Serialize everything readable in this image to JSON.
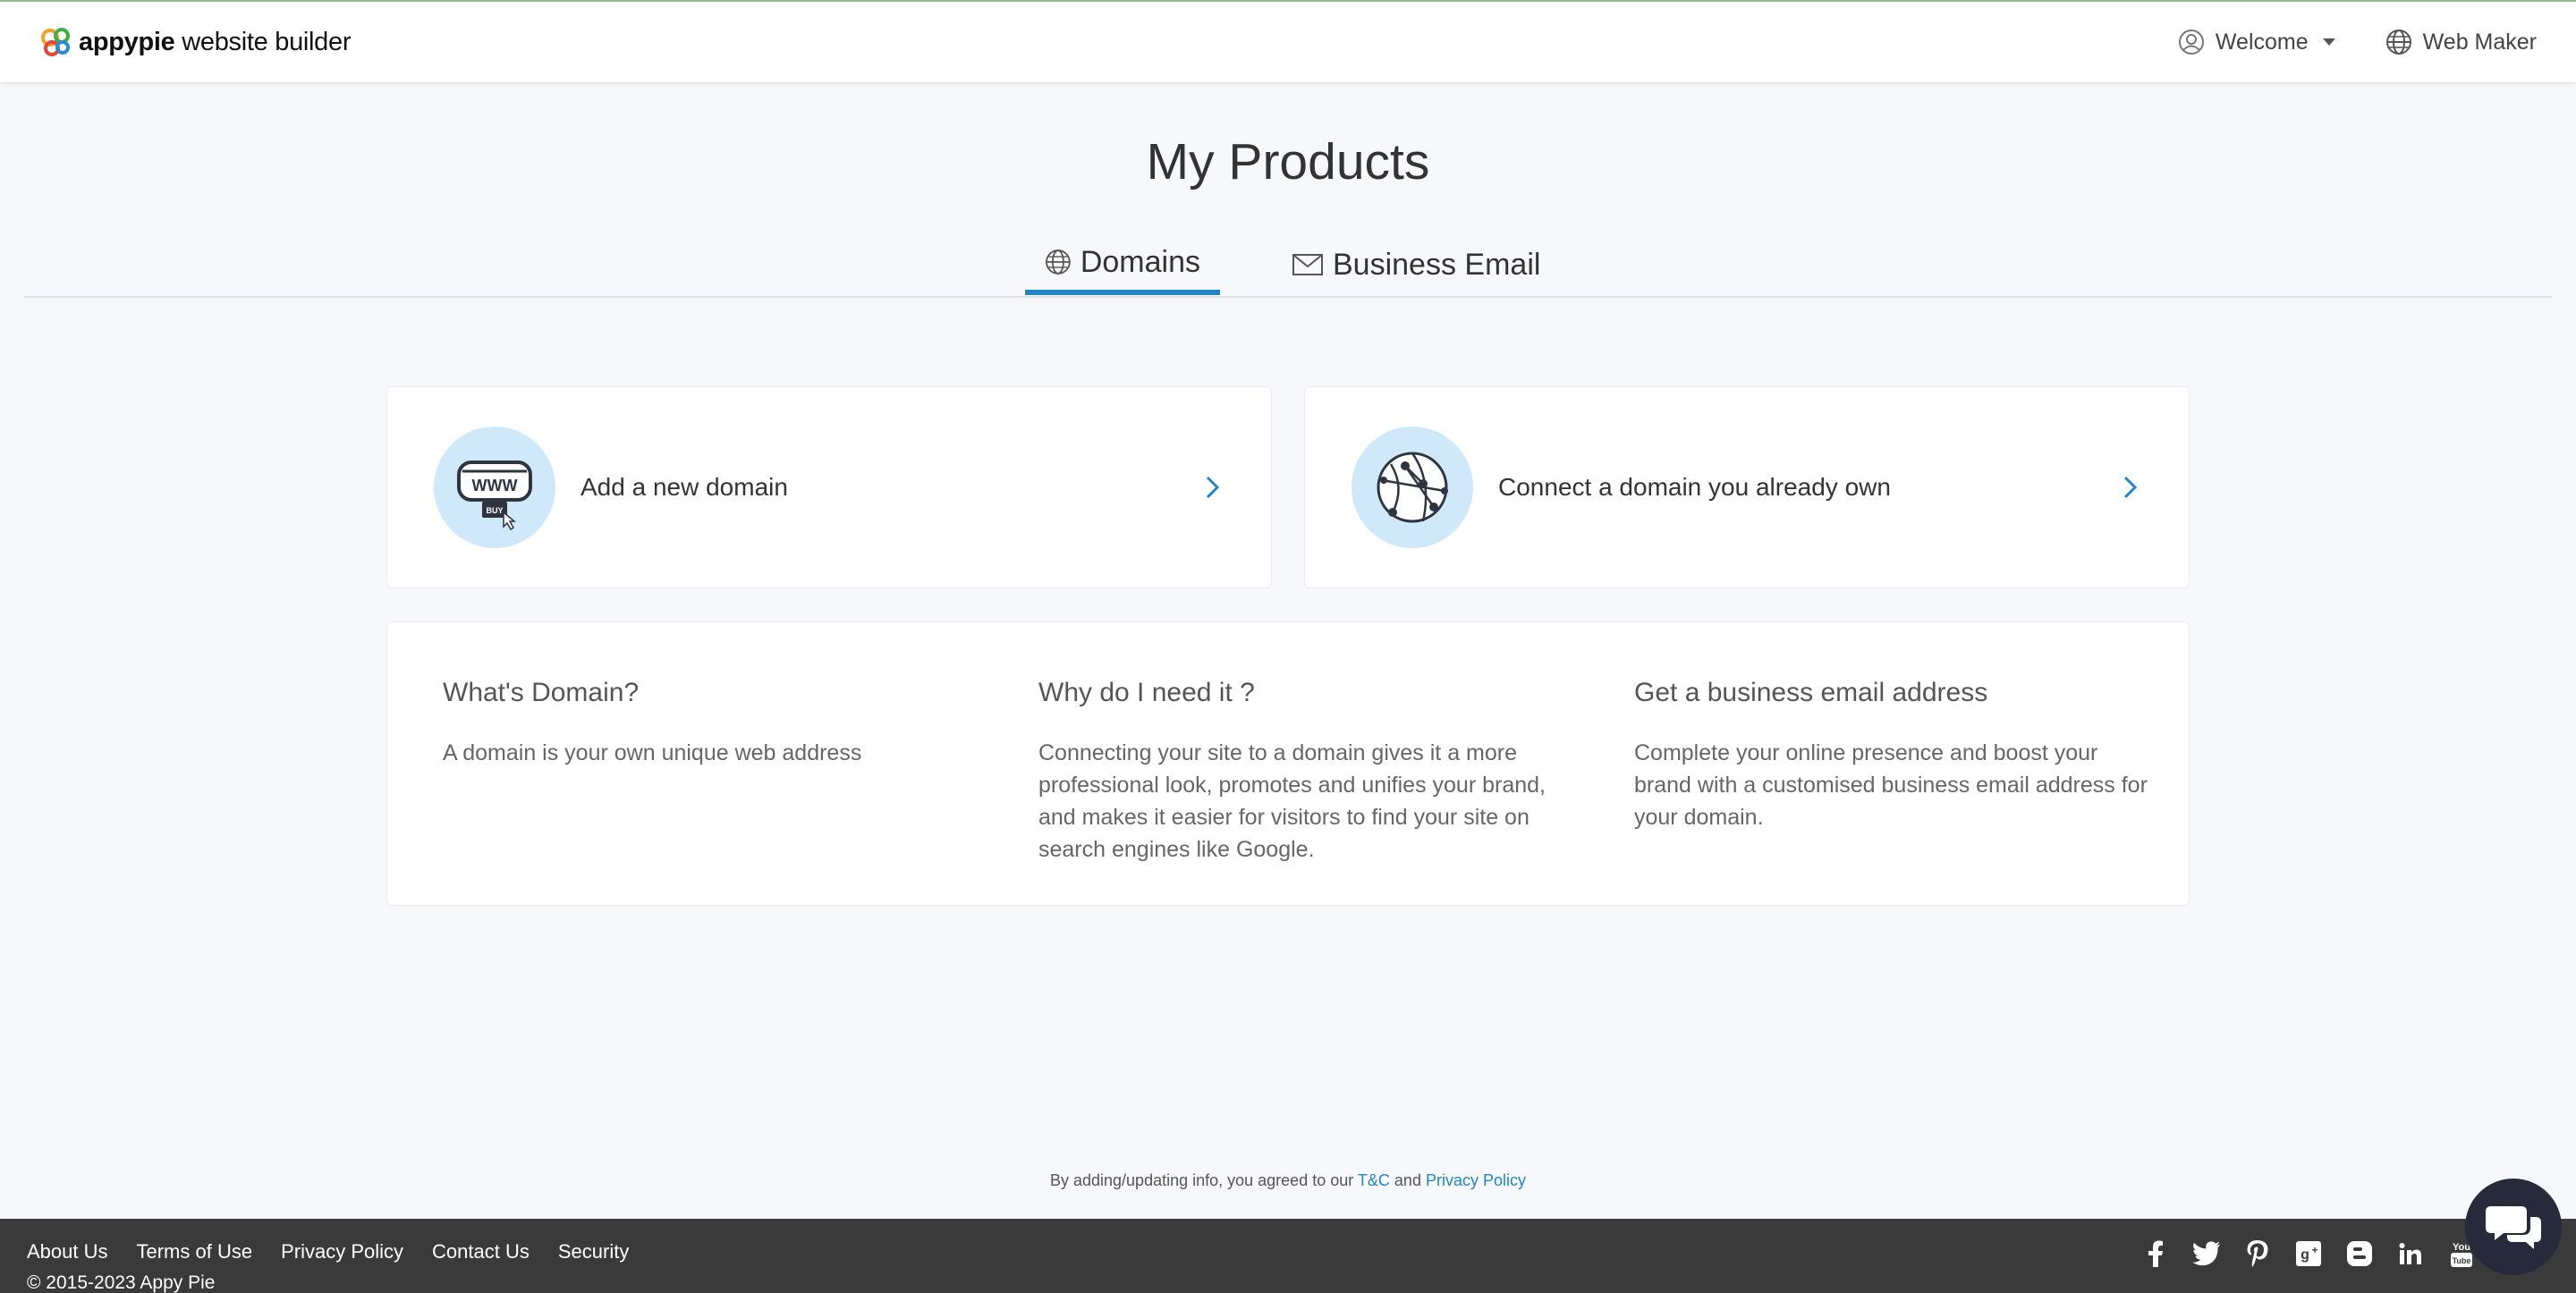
{
  "header": {
    "brand_bold": "appypie",
    "brand_rest": " website builder",
    "welcome_label": "Welcome",
    "webmaker_label": "Web Maker"
  },
  "page": {
    "title": "My Products"
  },
  "tabs": [
    {
      "label": "Domains",
      "active": true
    },
    {
      "label": "Business Email",
      "active": false
    }
  ],
  "cards": {
    "add_domain": "Add a new domain",
    "connect_domain": "Connect a domain you already own",
    "buy_badge": "BUY"
  },
  "info": {
    "what": {
      "title": "What's Domain?",
      "text": "A domain is your own unique web address"
    },
    "why": {
      "title": "Why do I need it ?",
      "text": "Connecting your site to a domain gives it a more professional look, promotes and unifies your brand, and makes it easier for visitors to find your site on search engines like Google."
    },
    "email": {
      "title": "Get a business email address",
      "text": "Complete your online presence and boost your brand with a customised business email address for your domain."
    }
  },
  "agreement": {
    "prefix": "By adding/updating info, you agreed to our ",
    "tc": "T&C",
    "and": " and ",
    "privacy": "Privacy Policy"
  },
  "footer": {
    "links": [
      "About Us",
      "Terms of Use",
      "Privacy Policy",
      "Contact Us",
      "Security"
    ],
    "copyright": "© 2015-2023 Appy Pie",
    "social": [
      "facebook-icon",
      "twitter-icon",
      "pinterest-icon",
      "google-plus-icon",
      "blogger-icon",
      "linkedin-icon",
      "youtube-icon"
    ]
  },
  "colors": {
    "accent": "#2384c6",
    "icon_bg": "#cfe9fb",
    "footer_bg": "#3a3a3a",
    "chat_bg": "#262a3a"
  }
}
